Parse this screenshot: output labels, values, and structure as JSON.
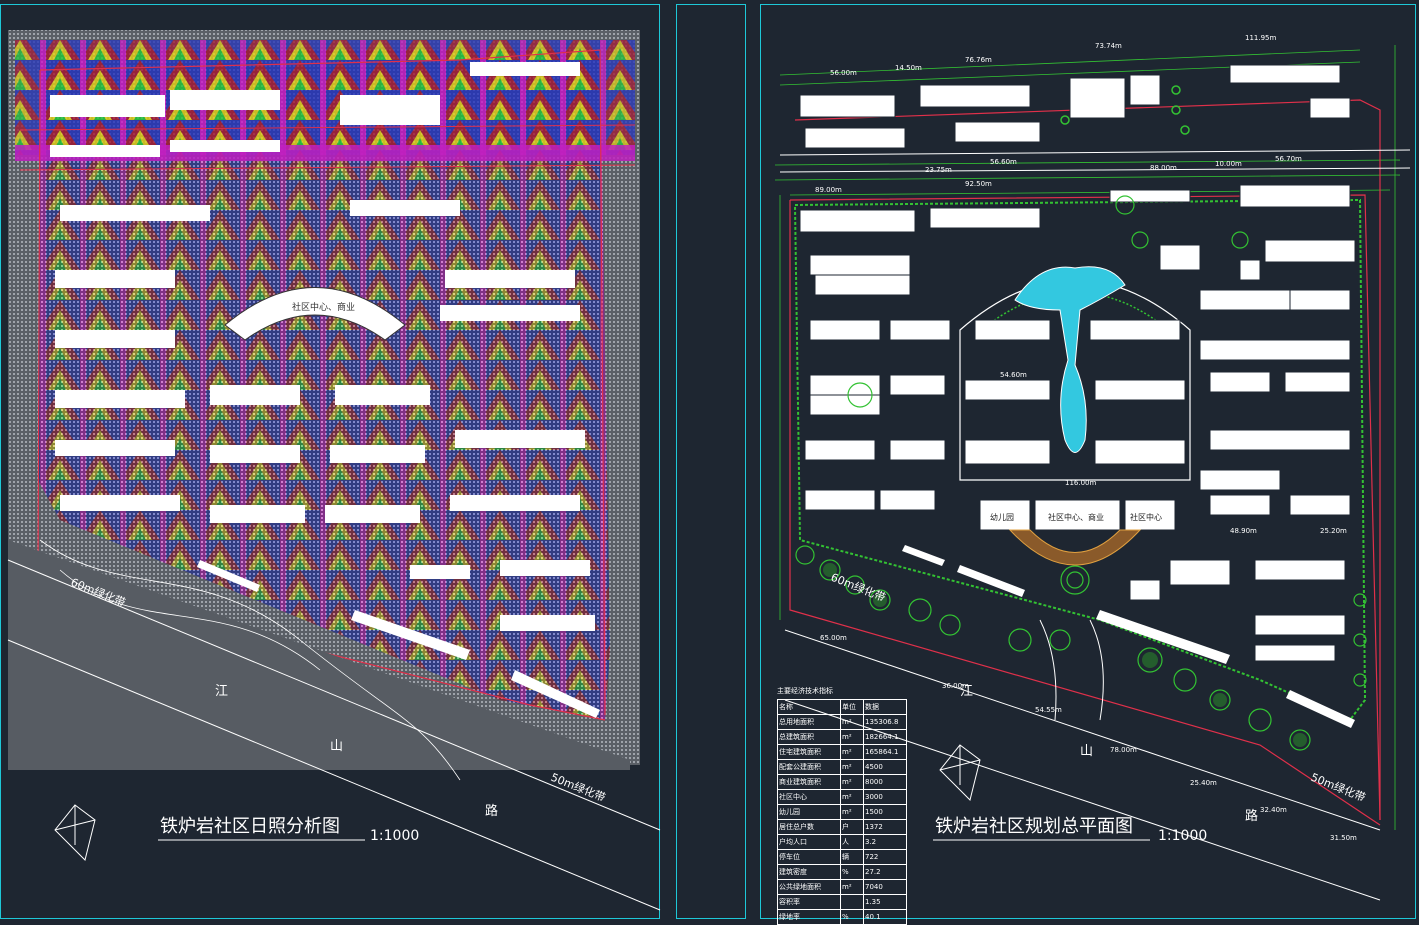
{
  "left_sheet": {
    "title": "铁炉岩社区日照分析图",
    "scale": "1:1000",
    "road_labels": [
      "60m绿化带",
      "江",
      "山",
      "路",
      "50m绿化带"
    ],
    "building_label": "社区中心、商业"
  },
  "right_sheet": {
    "title": "铁炉岩社区规划总平面图",
    "scale": "1:1000",
    "road_labels": [
      "60m绿化带",
      "江",
      "山",
      "路",
      "50m绿化带"
    ],
    "building_labels": [
      "幼儿园",
      "社区中心、商业",
      "社区中心"
    ],
    "dimensions": [
      "73.74m",
      "111.95m",
      "76.76m",
      "56.00m",
      "14.50m",
      "23.75m",
      "56.60m",
      "88.00m",
      "10.00m",
      "56.70m",
      "89.00m",
      "92.50m",
      "65.00m",
      "116.00m",
      "54.60m",
      "48.90m",
      "25.20m",
      "36.00m",
      "54.55m",
      "78.00m",
      "25.40m",
      "32.40m",
      "31.50m"
    ],
    "table": {
      "title": "主要经济技术指标",
      "headers": [
        "名称",
        "单位",
        "数据"
      ],
      "rows": [
        [
          "总用地面积",
          "m²",
          "135306.8"
        ],
        [
          "总建筑面积",
          "m²",
          "182664.1"
        ],
        [
          "住宅建筑面积",
          "m²",
          "165864.1"
        ],
        [
          "配套公建面积",
          "m²",
          "4500"
        ],
        [
          "商业建筑面积",
          "m²",
          "8000"
        ],
        [
          "社区中心",
          "m²",
          "3000"
        ],
        [
          "幼儿园",
          "m²",
          "1500"
        ],
        [
          "居住总户数",
          "户",
          "1372"
        ],
        [
          "户均人口",
          "人",
          "3.2"
        ],
        [
          "停车位",
          "辆",
          "722"
        ],
        [
          "建筑密度",
          "%",
          "27.2"
        ],
        [
          "公共绿地面积",
          "m²",
          "7040"
        ],
        [
          "容积率",
          "",
          "1.35"
        ],
        [
          "绿地率",
          "%",
          "40.1"
        ]
      ]
    }
  },
  "colors": {
    "background": "#1e2631",
    "frame": "#1ec8d8",
    "red_line": "#e0304a",
    "green_line": "#33c233",
    "water": "#33c8e0"
  }
}
